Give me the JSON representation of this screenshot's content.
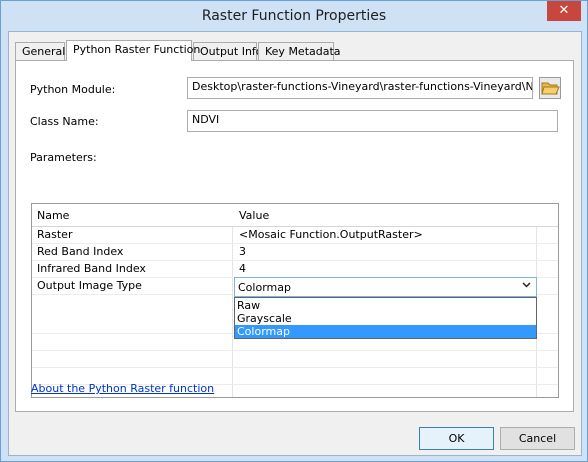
{
  "window": {
    "title": "Raster Function Properties",
    "close_glyph": "✕"
  },
  "tabs": [
    {
      "label": "General"
    },
    {
      "label": "Python Raster Function"
    },
    {
      "label": "Output Info"
    },
    {
      "label": "Key Metadata"
    }
  ],
  "form": {
    "python_module_label": "Python Module:",
    "python_module_value": "Desktop\\raster-functions-Vineyard\\raster-functions-Vineyard\\NDVI.py",
    "class_name_label": "Class Name:",
    "class_name_value": "NDVI",
    "parameters_label": "Parameters:"
  },
  "grid": {
    "columns": [
      "Name",
      "Value"
    ],
    "rows": [
      {
        "name": "Raster",
        "value": "<Mosaic Function.OutputRaster>"
      },
      {
        "name": "Red Band Index",
        "value": "3"
      },
      {
        "name": "Infrared Band Index",
        "value": "4"
      },
      {
        "name": "Output Image Type",
        "value": ""
      }
    ]
  },
  "combo": {
    "selected": "Colormap",
    "options": [
      "Raw",
      "Grayscale",
      "Colormap"
    ]
  },
  "link_text": "About the Python Raster function",
  "buttons": {
    "ok": "OK",
    "cancel": "Cancel"
  },
  "icons": {
    "folder": "open-folder-icon",
    "combo_arrow": "chevron-down-icon",
    "close": "close-icon"
  }
}
